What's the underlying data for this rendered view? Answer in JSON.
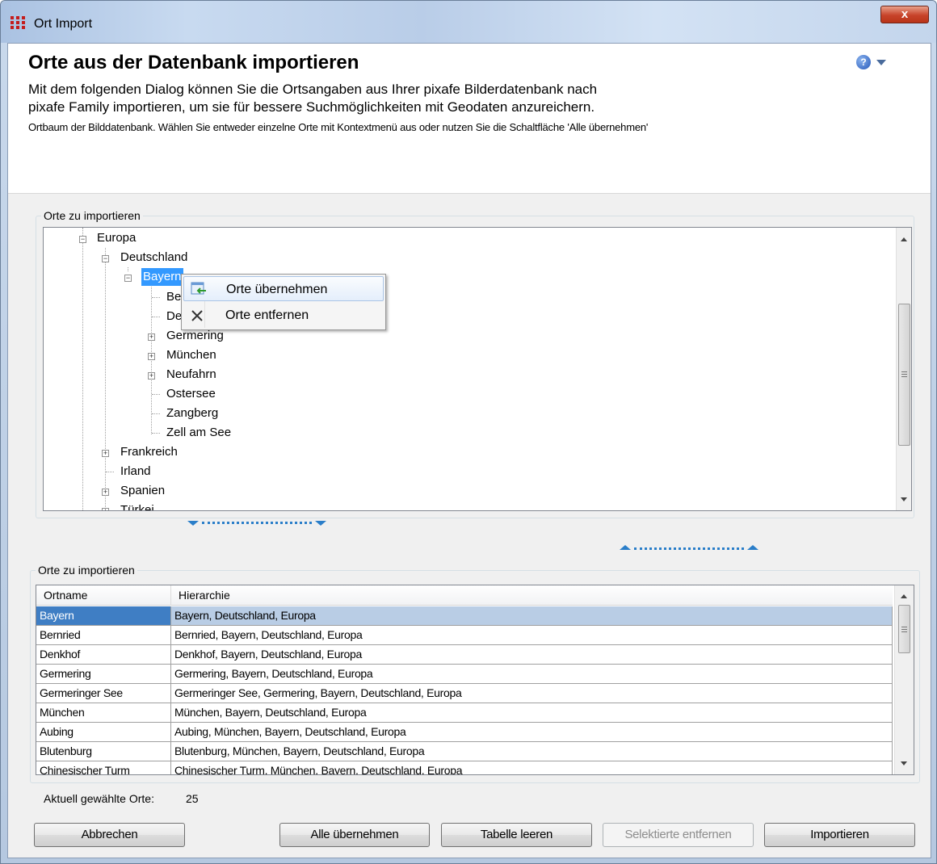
{
  "window": {
    "title": "Ort Import",
    "close_label": "x"
  },
  "header": {
    "title": "Orte aus der Datenbank importieren",
    "description_line1": "Mit dem folgenden Dialog können Sie die Ortsangaben aus Ihrer pixafe Bilderdatenbank nach",
    "description_line2": "pixafe Family importieren, um sie für bessere Suchmöglichkeiten mit Geodaten anzureichern.",
    "hint": "Ortbaum der Bilddatenbank. Wählen Sie entweder einzelne Orte mit Kontextmenü aus oder nutzen Sie die Schaltfläche 'Alle übernehmen'",
    "help_icon": "help-icon",
    "help_glyph": "?"
  },
  "tree_group": {
    "label": "Orte zu importieren",
    "nodes": {
      "europa": "Europa",
      "deutschland": "Deutschland",
      "bayern": "Bayern",
      "bernried": "Be",
      "denkhof": "De",
      "germering": "Germering",
      "muenchen": "München",
      "neufahrn": "Neufahrn",
      "ostersee": "Ostersee",
      "zangberg": "Zangberg",
      "zell": "Zell am See",
      "frankreich": "Frankreich",
      "irland": "Irland",
      "spanien": "Spanien",
      "tuerkei": "Türkei"
    }
  },
  "context_menu": {
    "item_add": "Orte übernehmen",
    "item_remove": "Orte entfernen"
  },
  "grid_group": {
    "label": "Orte zu importieren",
    "columns": [
      "Ortname",
      "Hierarchie"
    ],
    "rows": [
      {
        "name": "Bayern",
        "hierarchy": "Bayern, Deutschland, Europa"
      },
      {
        "name": "Bernried",
        "hierarchy": "Bernried, Bayern, Deutschland, Europa"
      },
      {
        "name": "Denkhof",
        "hierarchy": "Denkhof, Bayern, Deutschland, Europa"
      },
      {
        "name": "Germering",
        "hierarchy": "Germering, Bayern, Deutschland, Europa"
      },
      {
        "name": "Germeringer See",
        "hierarchy": "Germeringer See, Germering, Bayern, Deutschland, Europa"
      },
      {
        "name": "München",
        "hierarchy": "München, Bayern, Deutschland, Europa"
      },
      {
        "name": "Aubing",
        "hierarchy": "Aubing, München, Bayern, Deutschland, Europa"
      },
      {
        "name": "Blutenburg",
        "hierarchy": "Blutenburg, München, Bayern, Deutschland, Europa"
      },
      {
        "name": "Chinesischer Turm",
        "hierarchy": "Chinesischer Turm, München, Bayern, Deutschland, Europa"
      }
    ]
  },
  "status": {
    "label": "Aktuell gewählte Orte:",
    "value": "25"
  },
  "buttons": {
    "cancel": "Abbrechen",
    "take_all": "Alle übernehmen",
    "clear_table": "Tabelle leeren",
    "remove_selected": "Selektierte entfernen",
    "import": "Importieren"
  },
  "colors": {
    "selection": "#3399ff",
    "grid_selection": "#3f7ec4",
    "splitter": "#2a7ec9"
  }
}
